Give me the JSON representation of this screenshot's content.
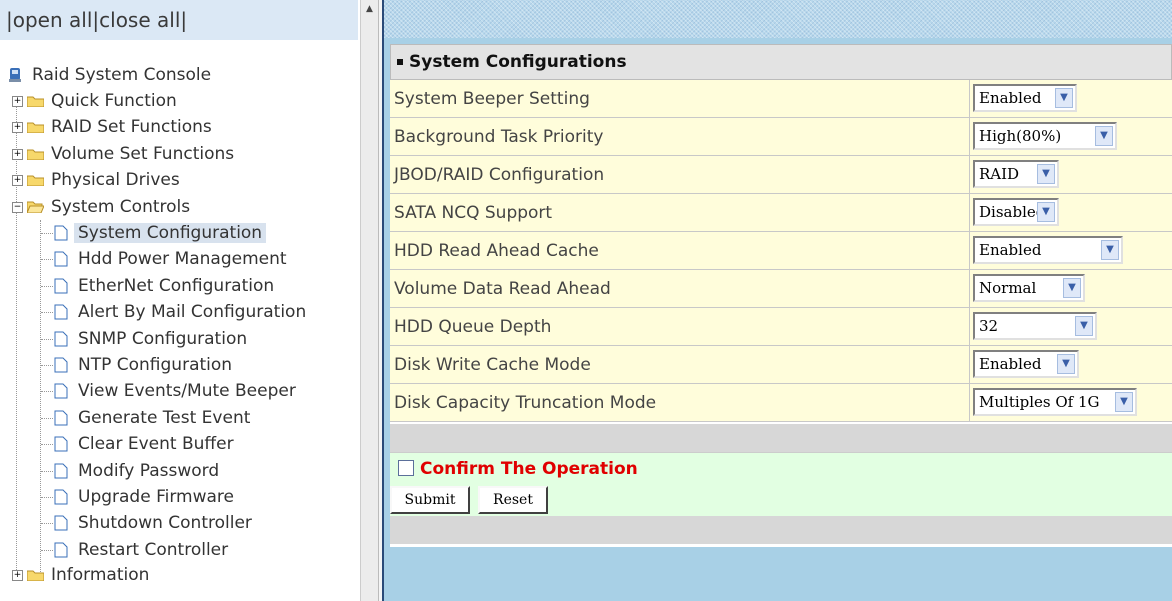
{
  "top_links": {
    "prefix": "|",
    "open_all": "open all",
    "sep": "|",
    "close_all": "close all",
    "suffix": "|"
  },
  "tree": {
    "root": "Raid System Console",
    "top_items": [
      {
        "label": "Quick Function"
      },
      {
        "label": "RAID Set Functions"
      },
      {
        "label": "Volume Set Functions"
      },
      {
        "label": "Physical Drives"
      },
      {
        "label": "System Controls"
      }
    ],
    "system_controls_children": [
      {
        "label": "System Configuration",
        "selected": true
      },
      {
        "label": "Hdd Power Management"
      },
      {
        "label": "EtherNet Configuration"
      },
      {
        "label": "Alert By Mail Configuration"
      },
      {
        "label": "SNMP Configuration"
      },
      {
        "label": "NTP Configuration"
      },
      {
        "label": "View Events/Mute Beeper"
      },
      {
        "label": "Generate Test Event"
      },
      {
        "label": "Clear Event Buffer"
      },
      {
        "label": "Modify Password"
      },
      {
        "label": "Upgrade Firmware"
      },
      {
        "label": "Shutdown Controller"
      },
      {
        "label": "Restart Controller"
      }
    ],
    "last_item": "Information"
  },
  "panel": {
    "title": "System Configurations",
    "rows": [
      {
        "label": "System Beeper Setting",
        "value": "Enabled"
      },
      {
        "label": "Background Task Priority",
        "value": "High(80%)"
      },
      {
        "label": "JBOD/RAID Configuration",
        "value": "RAID"
      },
      {
        "label": "SATA NCQ Support",
        "value": "Disabled"
      },
      {
        "label": "HDD Read Ahead Cache",
        "value": "Enabled"
      },
      {
        "label": "Volume Data Read Ahead",
        "value": "Normal"
      },
      {
        "label": "HDD Queue Depth",
        "value": "32"
      },
      {
        "label": "Disk Write Cache Mode",
        "value": "Enabled"
      },
      {
        "label": "Disk Capacity Truncation Mode",
        "value": "Multiples Of 1G"
      }
    ],
    "confirm_label": "Confirm The Operation",
    "confirm_checked": false,
    "submit_label": "Submit",
    "reset_label": "Reset"
  },
  "colors": {
    "row_bg": "#fffddb",
    "confirm_text": "#e00000",
    "confirm_bg": "#e2ffe2",
    "content_bg": "#a8d0e6",
    "selected_bg": "#d8e2ee"
  },
  "icons": {
    "root": "console-icon",
    "folder": "folder-icon",
    "folder_open": "folder-open-icon",
    "doc": "document-icon",
    "expand": "plus-icon",
    "collapse": "minus-icon",
    "dropdown": "chevron-down-icon"
  }
}
